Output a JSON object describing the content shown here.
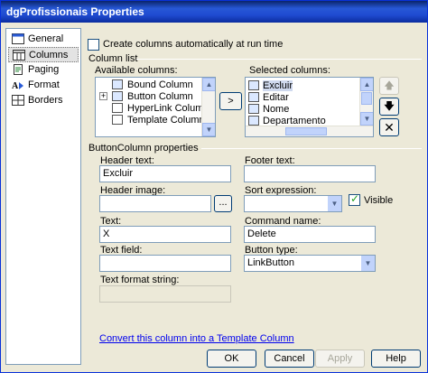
{
  "window": {
    "title": "dgProfissionais Properties"
  },
  "sidebar": {
    "items": [
      {
        "label": "General",
        "icon": "general-icon",
        "selected": false
      },
      {
        "label": "Columns",
        "icon": "columns-icon",
        "selected": true
      },
      {
        "label": "Paging",
        "icon": "paging-icon",
        "selected": false
      },
      {
        "label": "Format",
        "icon": "format-icon",
        "selected": false
      },
      {
        "label": "Borders",
        "icon": "borders-icon",
        "selected": false
      }
    ]
  },
  "main": {
    "auto_create_label": "Create columns automatically at run time",
    "auto_create_checked": false,
    "column_list_label": "Column list",
    "available_label": "Available columns:",
    "available_items": [
      "Bound Column",
      "Button Column",
      "HyperLink Column",
      "Template Column"
    ],
    "add_button_label": ">",
    "selected_label": "Selected columns:",
    "selected_items": [
      "Excluir",
      "Editar",
      "Nome",
      "Departamento"
    ],
    "properties_label": "ButtonColumn properties",
    "header_text_label": "Header text:",
    "header_text_value": "Excluir",
    "footer_text_label": "Footer text:",
    "footer_text_value": "",
    "header_image_label": "Header image:",
    "header_image_value": "",
    "browse_button_label": "...",
    "sort_expression_label": "Sort expression:",
    "sort_expression_value": "",
    "visible_label": "Visible",
    "visible_checked": true,
    "text_label": "Text:",
    "text_value": "X",
    "command_name_label": "Command name:",
    "command_name_value": "Delete",
    "text_field_label": "Text field:",
    "text_field_value": "",
    "button_type_label": "Button type:",
    "button_type_value": "LinkButton",
    "text_format_label": "Text format string:",
    "text_format_value": "",
    "convert_link": "Convert this column into a Template Column"
  },
  "footer": {
    "ok_label": "OK",
    "cancel_label": "Cancel",
    "apply_label": "Apply",
    "help_label": "Help"
  },
  "colors": {
    "title_bar": "#0a246a",
    "dialog_bg": "#ece9d8",
    "link": "#0000ee",
    "border": "#7f9db9"
  }
}
